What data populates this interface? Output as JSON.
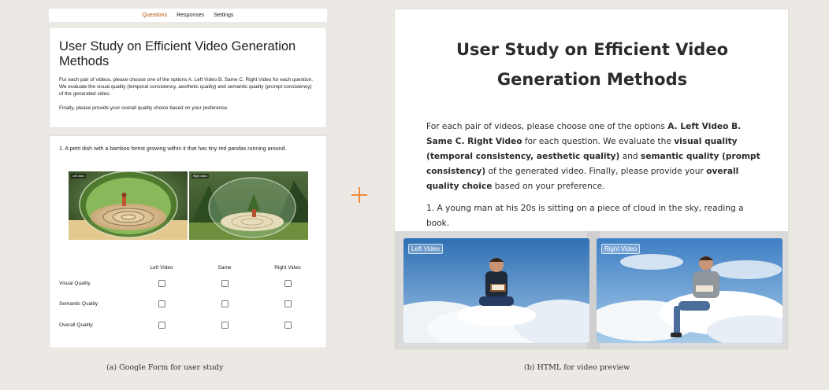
{
  "form": {
    "tabs": [
      "Questions",
      "Responses",
      "Settings"
    ],
    "title": "User Study on Efficient Video Generation Methods",
    "description": "For each pair of videos, please choose one of the options A. Left Video B. Same C. Right Video for each question. We evaluate the visual quality (temporal consistency, aesthetic quality) and semantic quality (prompt consistency) of the generated video.",
    "final_note": "Finally, please provide your overall quality choice based on your preference.",
    "question": "1. A petri dish with a bamboo forest growing within it that has tiny red pandas running around.",
    "left_tag": "Left video",
    "right_tag": "Right video",
    "columns": [
      "Left Video",
      "Same",
      "Right Video"
    ],
    "rows": [
      "Visual Quality",
      "Semantic Quality",
      "Overall Quality"
    ]
  },
  "captions": {
    "a": "(a) Google Form for user study",
    "b": "(b) HTML for video preview"
  },
  "preview": {
    "title": "User Study on Efficient Video Generation Methods",
    "desc_parts": [
      "For each pair of videos, please choose one of the options ",
      "A. Left Video B. Same C. Right Video",
      " for each question. We evaluate the ",
      "visual quality (temporal consistency, aesthetic quality)",
      " and ",
      "semantic quality (prompt consistency)",
      " of the generated video. Finally, please provide your ",
      "overall quality choice",
      " based on your preference."
    ],
    "question": "1. A young man at his 20s is sitting on a piece of cloud in the sky, reading a book.",
    "left_label": "Left Video",
    "right_label": "Right Video"
  },
  "colors": {
    "accent_tab": "#b3540b",
    "plus": "#f08a3c",
    "background": "#ece8e3"
  }
}
